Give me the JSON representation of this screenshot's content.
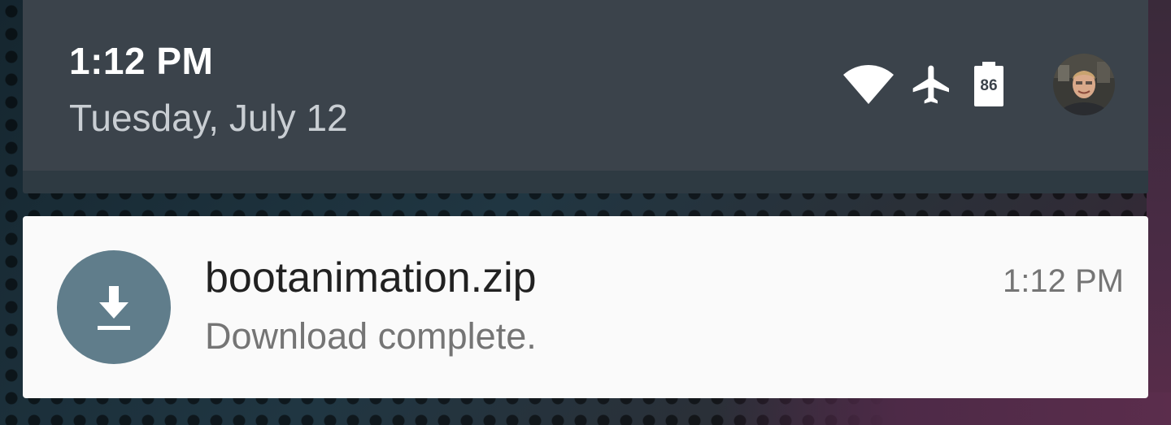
{
  "header": {
    "time": "1:12 PM",
    "date": "Tuesday, July 12",
    "status_icons": [
      "wifi-icon",
      "airplane-icon",
      "battery-icon"
    ],
    "battery_level": "86"
  },
  "notification": {
    "icon": "download-icon",
    "title": "bootanimation.zip",
    "text": "Download complete.",
    "time": "1:12 PM",
    "accent_color": "#607d8b"
  },
  "colors": {
    "header_bg": "#3b434b",
    "card_bg": "#fafafa"
  }
}
